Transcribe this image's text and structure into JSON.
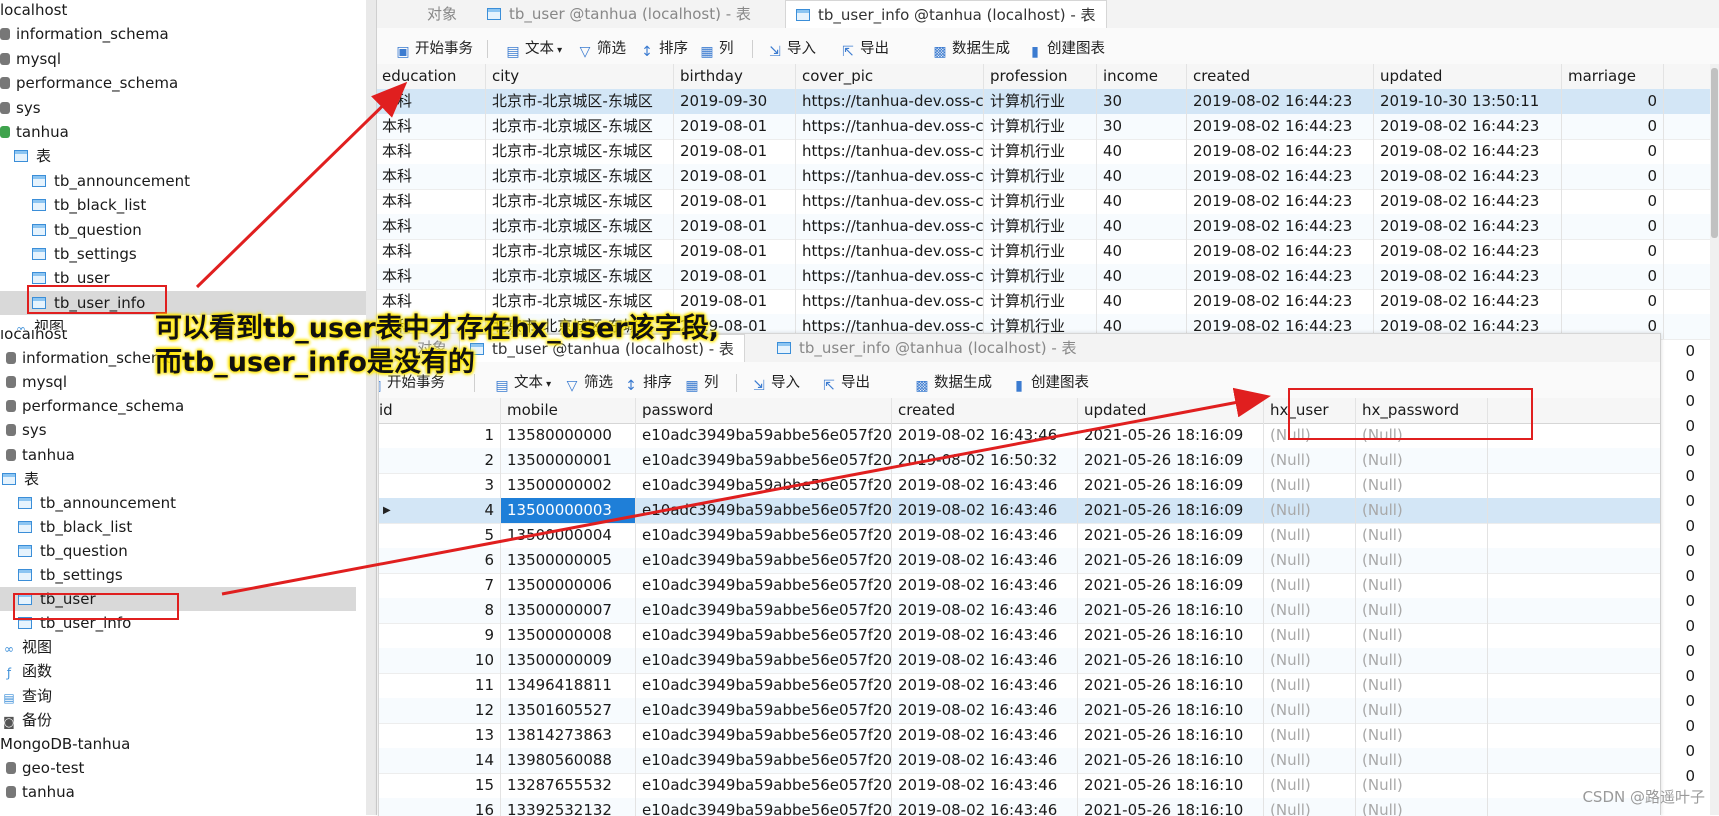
{
  "sidebar_top": {
    "items": [
      {
        "label": "localhost",
        "indent": 0,
        "kind": "root"
      },
      {
        "label": "information_schema",
        "indent": 0,
        "kind": "db"
      },
      {
        "label": "mysql",
        "indent": 0,
        "kind": "db"
      },
      {
        "label": "performance_schema",
        "indent": 0,
        "kind": "db"
      },
      {
        "label": "sys",
        "indent": 0,
        "kind": "db"
      },
      {
        "label": "tanhua",
        "indent": 0,
        "kind": "db-green"
      },
      {
        "label": "表",
        "indent": 1,
        "kind": "folder"
      },
      {
        "label": "tb_announcement",
        "indent": 2,
        "kind": "table"
      },
      {
        "label": "tb_black_list",
        "indent": 2,
        "kind": "table"
      },
      {
        "label": "tb_question",
        "indent": 2,
        "kind": "table"
      },
      {
        "label": "tb_settings",
        "indent": 2,
        "kind": "table"
      },
      {
        "label": "tb_user",
        "indent": 2,
        "kind": "table"
      },
      {
        "label": "tb_user_info",
        "indent": 2,
        "kind": "table",
        "selected": true
      },
      {
        "label": "视图",
        "indent": 1,
        "kind": "view"
      }
    ]
  },
  "sidebar_bottom": {
    "items": [
      {
        "label": "localhost",
        "kind": "root"
      },
      {
        "label": "information_schema",
        "kind": "db"
      },
      {
        "label": "mysql",
        "kind": "db"
      },
      {
        "label": "performance_schema",
        "kind": "db"
      },
      {
        "label": "sys",
        "kind": "db"
      },
      {
        "label": "tanhua",
        "kind": "db"
      },
      {
        "label": "表",
        "kind": "folder"
      },
      {
        "label": "tb_announcement",
        "kind": "table"
      },
      {
        "label": "tb_black_list",
        "kind": "table"
      },
      {
        "label": "tb_question",
        "kind": "table"
      },
      {
        "label": "tb_settings",
        "kind": "table"
      },
      {
        "label": "tb_user",
        "kind": "table",
        "selected": true
      },
      {
        "label": "tb_user_info",
        "kind": "table"
      },
      {
        "label": "视图",
        "kind": "view"
      },
      {
        "label": "函数",
        "kind": "func"
      },
      {
        "label": "查询",
        "kind": "query"
      },
      {
        "label": "备份",
        "kind": "backup"
      },
      {
        "label": "MongoDB-tanhua",
        "kind": "root"
      },
      {
        "label": "geo-test",
        "kind": "db"
      },
      {
        "label": "tanhua",
        "kind": "db"
      }
    ]
  },
  "toolbar": {
    "begin_txn": "开始事务",
    "text": "文本",
    "filter": "筛选",
    "sort": "排序",
    "columns": "列",
    "import": "导入",
    "export": "导出",
    "datagen": "数据生成",
    "chart": "创建图表"
  },
  "top_panel": {
    "tabs": [
      "对象",
      "tb_user @tanhua (localhost) - 表",
      "tb_user_info @tanhua (localhost) - 表"
    ],
    "columns": [
      "education",
      "city",
      "birthday",
      "cover_pic",
      "profession",
      "income",
      "created",
      "updated",
      "marriage"
    ],
    "rows": [
      [
        "本科",
        "北京市-北京城区-东城区",
        "2019-09-30",
        "https://tanhua-dev.oss-c",
        "计算机行业",
        "30",
        "2019-08-02 16:44:23",
        "2019-10-30 13:50:11",
        "0"
      ],
      [
        "本科",
        "北京市-北京城区-东城区",
        "2019-08-01",
        "https://tanhua-dev.oss-c",
        "计算机行业",
        "30",
        "2019-08-02 16:44:23",
        "2019-08-02 16:44:23",
        "0"
      ],
      [
        "本科",
        "北京市-北京城区-东城区",
        "2019-08-01",
        "https://tanhua-dev.oss-c",
        "计算机行业",
        "40",
        "2019-08-02 16:44:23",
        "2019-08-02 16:44:23",
        "0"
      ],
      [
        "本科",
        "北京市-北京城区-东城区",
        "2019-08-01",
        "https://tanhua-dev.oss-c",
        "计算机行业",
        "40",
        "2019-08-02 16:44:23",
        "2019-08-02 16:44:23",
        "0"
      ],
      [
        "本科",
        "北京市-北京城区-东城区",
        "2019-08-01",
        "https://tanhua-dev.oss-c",
        "计算机行业",
        "40",
        "2019-08-02 16:44:23",
        "2019-08-02 16:44:23",
        "0"
      ],
      [
        "本科",
        "北京市-北京城区-东城区",
        "2019-08-01",
        "https://tanhua-dev.oss-c",
        "计算机行业",
        "40",
        "2019-08-02 16:44:23",
        "2019-08-02 16:44:23",
        "0"
      ],
      [
        "本科",
        "北京市-北京城区-东城区",
        "2019-08-01",
        "https://tanhua-dev.oss-c",
        "计算机行业",
        "40",
        "2019-08-02 16:44:23",
        "2019-08-02 16:44:23",
        "0"
      ],
      [
        "本科",
        "北京市-北京城区-东城区",
        "2019-08-01",
        "https://tanhua-dev.oss-c",
        "计算机行业",
        "40",
        "2019-08-02 16:44:23",
        "2019-08-02 16:44:23",
        "0"
      ],
      [
        "本科",
        "北京市-北京城区-东城区",
        "2019-08-01",
        "https://tanhua-dev.oss-c",
        "计算机行业",
        "40",
        "2019-08-02 16:44:23",
        "2019-08-02 16:44:23",
        "0"
      ],
      [
        "本科",
        "北京市-北京城区-东城区",
        "2019-08-01",
        "https://tanhua-dev.oss-c",
        "计算机行业",
        "40",
        "2019-08-02 16:44:23",
        "2019-08-02 16:44:23",
        "0"
      ]
    ],
    "marriage_tail": [
      "0",
      "0",
      "0",
      "0",
      "0",
      "0",
      "0",
      "0",
      "0",
      "0",
      "0",
      "0",
      "0",
      "0",
      "0",
      "0",
      "0",
      "0"
    ]
  },
  "bottom_panel": {
    "tabs": [
      "对象",
      "tb_user @tanhua (localhost) - 表",
      "tb_user_info @tanhua (localhost) - 表"
    ],
    "columns": [
      "id",
      "mobile",
      "password",
      "created",
      "updated",
      "hx_user",
      "hx_password"
    ],
    "null_text": "(Null)",
    "rows": [
      [
        "1",
        "13580000000",
        "e10adc3949ba59abbe56e057f20f",
        "2019-08-02 16:43:46",
        "2021-05-26 18:16:09"
      ],
      [
        "2",
        "13500000001",
        "e10adc3949ba59abbe56e057f20f",
        "2019-08-02 16:50:32",
        "2021-05-26 18:16:09"
      ],
      [
        "3",
        "13500000002",
        "e10adc3949ba59abbe56e057f20f",
        "2019-08-02 16:43:46",
        "2021-05-26 18:16:09"
      ],
      [
        "4",
        "13500000003",
        "e10adc3949ba59abbe56e057f20f",
        "2019-08-02 16:43:46",
        "2021-05-26 18:16:09"
      ],
      [
        "5",
        "13500000004",
        "e10adc3949ba59abbe56e057f20f",
        "2019-08-02 16:43:46",
        "2021-05-26 18:16:09"
      ],
      [
        "6",
        "13500000005",
        "e10adc3949ba59abbe56e057f20f",
        "2019-08-02 16:43:46",
        "2021-05-26 18:16:09"
      ],
      [
        "7",
        "13500000006",
        "e10adc3949ba59abbe56e057f20f",
        "2019-08-02 16:43:46",
        "2021-05-26 18:16:09"
      ],
      [
        "8",
        "13500000007",
        "e10adc3949ba59abbe56e057f20f",
        "2019-08-02 16:43:46",
        "2021-05-26 18:16:10"
      ],
      [
        "9",
        "13500000008",
        "e10adc3949ba59abbe56e057f20f",
        "2019-08-02 16:43:46",
        "2021-05-26 18:16:10"
      ],
      [
        "10",
        "13500000009",
        "e10adc3949ba59abbe56e057f20f",
        "2019-08-02 16:43:46",
        "2021-05-26 18:16:10"
      ],
      [
        "11",
        "13496418811",
        "e10adc3949ba59abbe56e057f20f",
        "2019-08-02 16:43:46",
        "2021-05-26 18:16:10"
      ],
      [
        "12",
        "13501605527",
        "e10adc3949ba59abbe56e057f20f",
        "2019-08-02 16:43:46",
        "2021-05-26 18:16:10"
      ],
      [
        "13",
        "13814273863",
        "e10adc3949ba59abbe56e057f20f",
        "2019-08-02 16:43:46",
        "2021-05-26 18:16:10"
      ],
      [
        "14",
        "13980560088",
        "e10adc3949ba59abbe56e057f20f",
        "2019-08-02 16:43:46",
        "2021-05-26 18:16:10"
      ],
      [
        "15",
        "13287655532",
        "e10adc3949ba59abbe56e057f20f",
        "2019-08-02 16:43:46",
        "2021-05-26 18:16:10"
      ],
      [
        "16",
        "13392532132",
        "e10adc3949ba59abbe56e057f20f",
        "2019-08-02 16:43:46",
        "2021-05-26 18:16:10"
      ]
    ]
  },
  "annotation": {
    "line1": "可以看到tb_user表中才存在hx_user该字段,",
    "line2": "而tb_user_info是没有的"
  },
  "watermark": "CSDN @路遥叶子",
  "colors": {
    "annotation_red": "#e01f1f",
    "highlight_blue": "#1f7fd8",
    "highlight_yellow": "#ffe600"
  }
}
